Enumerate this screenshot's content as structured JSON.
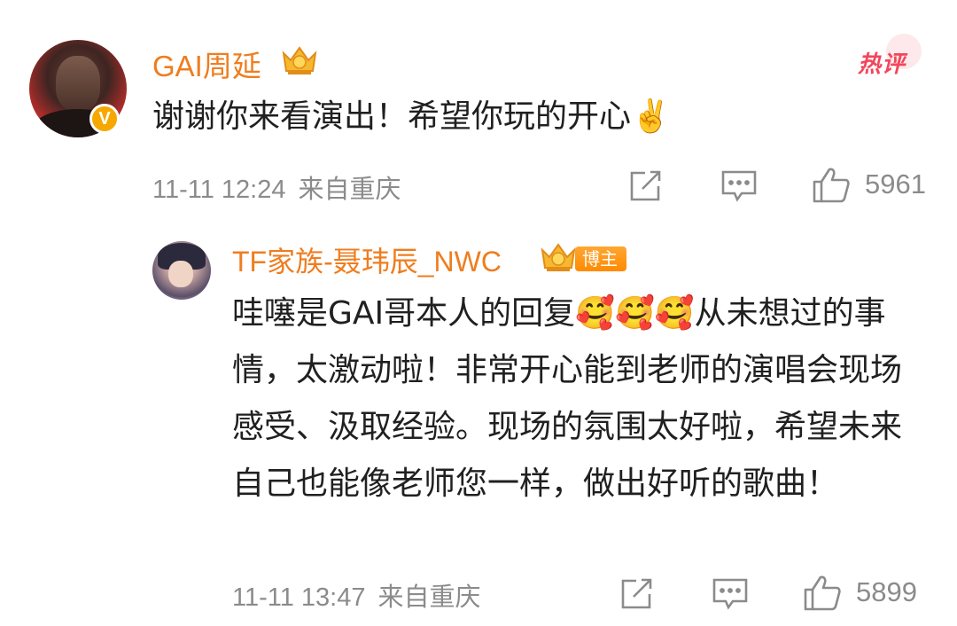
{
  "comment": {
    "author": "GAI周延",
    "text": "谢谢你来看演出！希望你玩的开心✌️",
    "time": "11-11 12:24",
    "location": "来自重庆",
    "likes": "5961",
    "hot_label": "热评"
  },
  "reply": {
    "author": "TF家族-聂玮辰_NWC",
    "badge": "博主",
    "text": "哇噻是GAI哥本人的回复🥰🥰🥰从未想过的事情，太激动啦！非常开心能到老师的演唱会现场感受、汲取经验。现场的氛围太好啦，希望未来自己也能像老师您一样，做出好听的歌曲！",
    "time": "11-11 13:47",
    "location": "来自重庆",
    "likes": "5899"
  },
  "colors": {
    "username": "#ef7d1f",
    "meta": "#8b8b8b",
    "hot": "#f2465b",
    "badge": "#ff8a00"
  },
  "icons": [
    "share-icon",
    "comment-icon",
    "like-icon",
    "crown-icon",
    "verified-icon"
  ]
}
